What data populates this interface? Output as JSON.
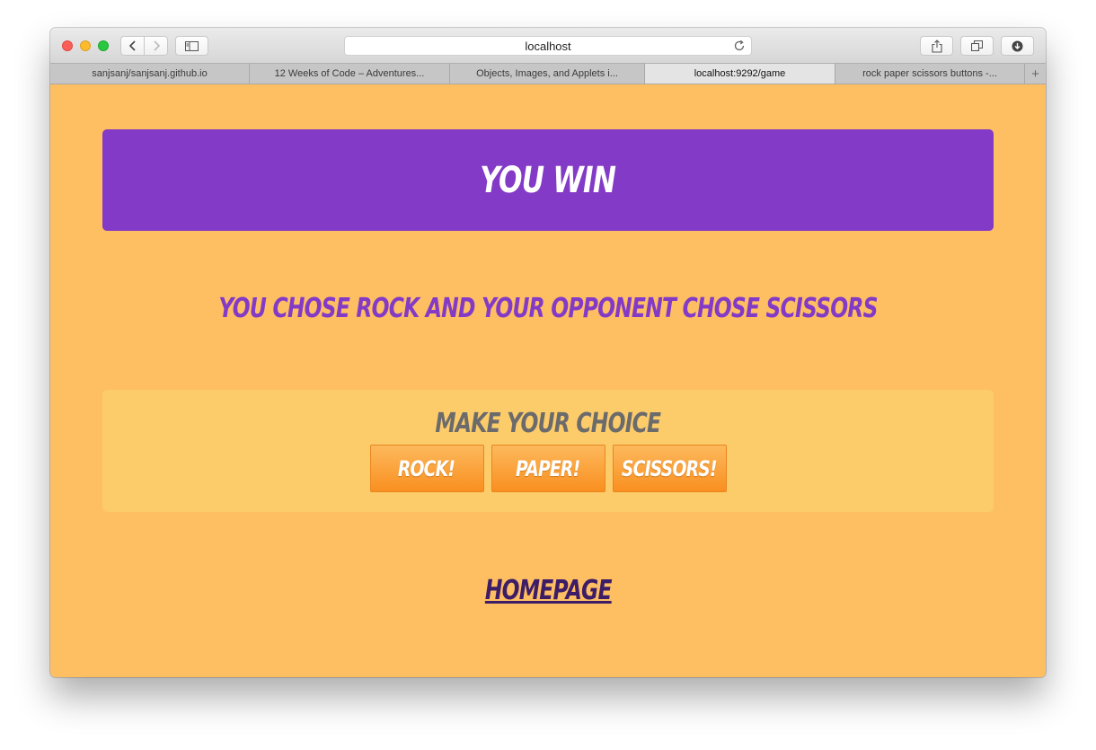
{
  "browser": {
    "address": "localhost",
    "tabs": [
      {
        "label": "sanjsanj/sanjsanj.github.io",
        "active": false
      },
      {
        "label": "12 Weeks of Code – Adventures...",
        "active": false
      },
      {
        "label": "Objects, Images, and Applets i...",
        "active": false
      },
      {
        "label": "localhost:9292/game",
        "active": true
      },
      {
        "label": "rock paper scissors buttons -...",
        "active": false
      }
    ],
    "new_tab_label": "+"
  },
  "page": {
    "banner_title": "YOU WIN",
    "result_text": "YOU CHOSE ROCK AND YOUR OPPONENT CHOSE SCISSORS",
    "choice_heading": "MAKE YOUR CHOICE",
    "buttons": {
      "rock": "ROCK!",
      "paper": "PAPER!",
      "scissors": "SCISSORS!"
    },
    "homepage_link": "HOMEPAGE"
  },
  "colors": {
    "background": "#febe62",
    "banner": "#833ac6",
    "panel": "#fccb6a",
    "button": "#f98f20",
    "link": "#3e1d67"
  }
}
